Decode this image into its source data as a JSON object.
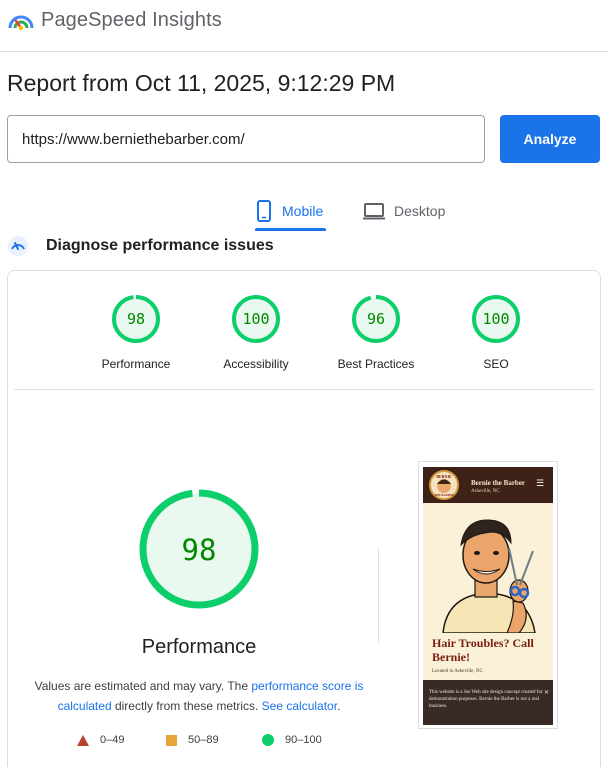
{
  "app": {
    "title": "PageSpeed Insights"
  },
  "report": {
    "title": "Report from Oct 11, 2025, 9:12:29 PM"
  },
  "url_input": {
    "value": "https://www.berniethebarber.com/"
  },
  "analyze_label": "Analyze",
  "tabs": [
    {
      "label": "Mobile",
      "selected": true
    },
    {
      "label": "Desktop",
      "selected": false
    }
  ],
  "diagnose_title": "Diagnose performance issues",
  "scores": [
    {
      "value": 98,
      "label": "Performance"
    },
    {
      "value": 100,
      "label": "Accessibility"
    },
    {
      "value": 96,
      "label": "Best Practices"
    },
    {
      "value": 100,
      "label": "SEO"
    }
  ],
  "main_score": {
    "value": 98,
    "title": "Performance"
  },
  "disclaimer": {
    "prefix": "Values are estimated and may vary. The ",
    "link1": "performance score is calculated",
    "middle": " directly from these metrics. ",
    "link2": "See calculator",
    "suffix": "."
  },
  "legend": [
    {
      "label": "0–49",
      "color": "#b5452c"
    },
    {
      "label": "50–89",
      "color": "#e8a33a"
    },
    {
      "label": "90–100",
      "color": "#0cce6b"
    }
  ],
  "colors": {
    "good": "#0cce6b",
    "good_text": "#008800",
    "good_bg": "#e9f9ef",
    "accent": "#1a73e8"
  },
  "screenshot": {
    "site_name": "Bernie the Barber",
    "site_location": "Asheville, NC",
    "logo_text_top": "BERNIE",
    "logo_text_bottom": "THE BARBER",
    "headline": "Hair Troubles? Call Bernie!",
    "subline": "Located in Asheville, NC",
    "banner_text": "This website is a Joe Web site design concept created for demonstration purposes. Bernie the Barber is not a real business."
  }
}
